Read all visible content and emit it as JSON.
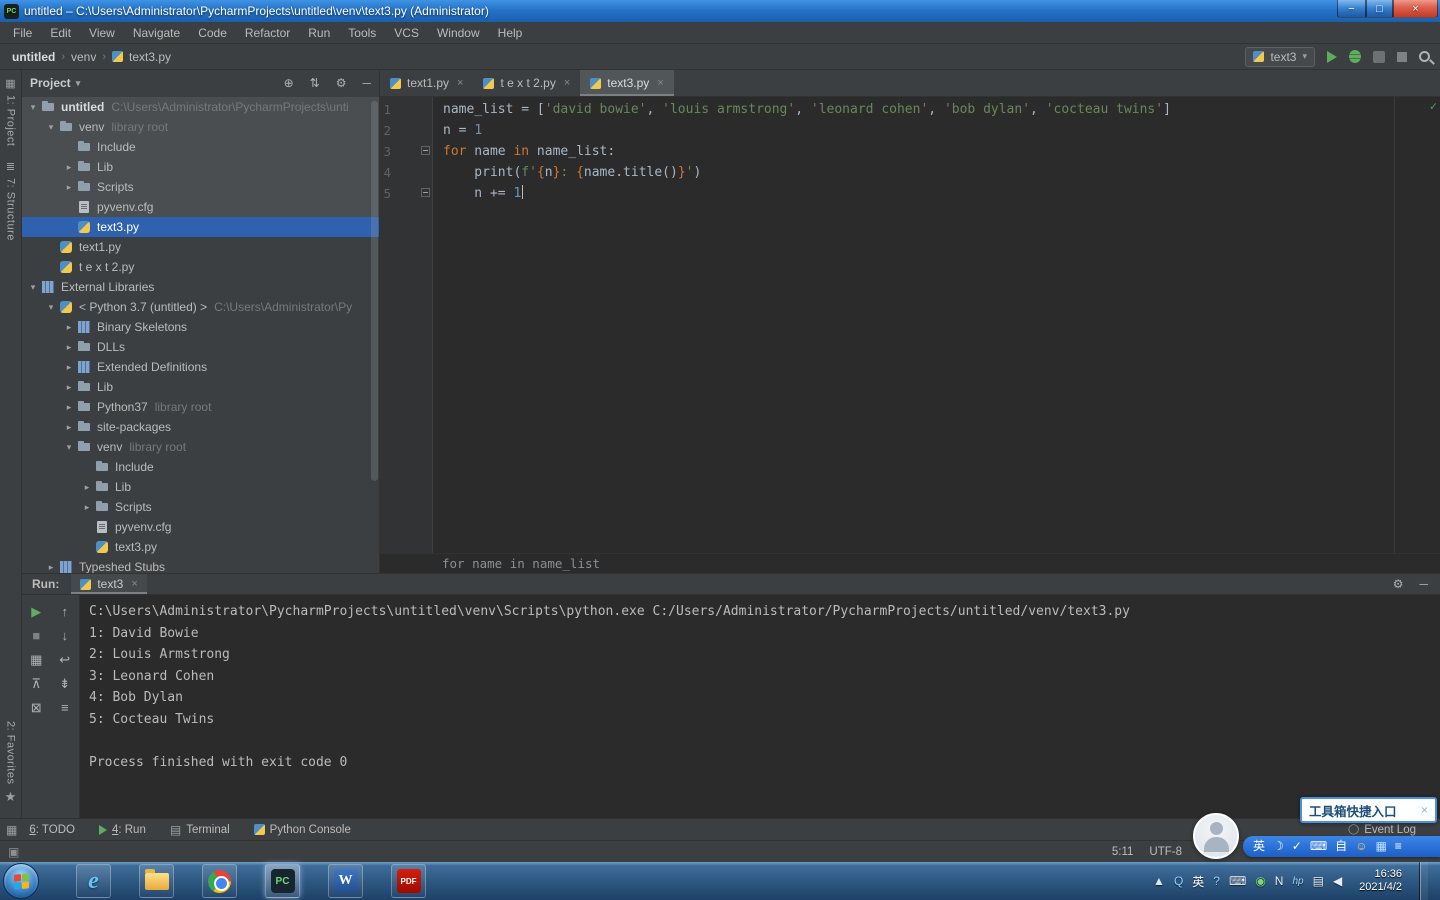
{
  "window": {
    "title": "untitled – C:\\Users\\Administrator\\PycharmProjects\\untitled\\venv\\text3.py (Administrator)",
    "app_icon": "PC"
  },
  "icons": {
    "min": "−",
    "max": "□",
    "close": "×",
    "tree_expanded": "▾",
    "tree_collapsed": "▸",
    "breadcrumb_sep": "›",
    "dropdown": "▾",
    "tab_close": "×",
    "check": "✓",
    "terminal": "▤",
    "circle": "◯",
    "panel_toggle": "▣",
    "switcher": "▦"
  },
  "colors": {
    "selection": "#2E62AE",
    "accent_green": "#5CAD5C",
    "title_blue": "#2573C8",
    "string_green": "#6A8759",
    "keyword_orange": "#CC7832"
  },
  "menu": [
    "File",
    "Edit",
    "View",
    "Navigate",
    "Code",
    "Refactor",
    "Run",
    "Tools",
    "VCS",
    "Window",
    "Help"
  ],
  "toolbar": {
    "breadcrumbs": [
      "untitled",
      "venv",
      "text3.py"
    ],
    "run_config": "text3"
  },
  "left_stripe": {
    "top": [
      {
        "label": "1: Project",
        "icon": "▦"
      },
      {
        "label": "7: Structure",
        "icon": "≣"
      }
    ],
    "bottom": [
      {
        "label": "2: Favorites",
        "icon": "★"
      }
    ]
  },
  "project_panel": {
    "header": "Project",
    "header_icons": [
      {
        "name": "locate-icon",
        "glyph": "⊕"
      },
      {
        "name": "collapse-all-icon",
        "glyph": "⇅"
      },
      {
        "name": "settings-icon",
        "glyph": "⚙"
      },
      {
        "name": "hide-panel-icon",
        "glyph": "─"
      }
    ],
    "tree": [
      {
        "label": "untitled",
        "suffix": "C:\\Users\\Administrator\\PycharmProjects\\unti",
        "level": 0,
        "icon": "folder",
        "arrow": "down",
        "bold": true,
        "light": true
      },
      {
        "label": "venv",
        "suffix": "library root",
        "level": 1,
        "icon": "folder",
        "arrow": "down",
        "light": true
      },
      {
        "label": "Include",
        "level": 2,
        "icon": "folder",
        "arrow": "none",
        "light": true
      },
      {
        "label": "Lib",
        "level": 2,
        "icon": "folder",
        "arrow": "right",
        "light": true
      },
      {
        "label": "Scripts",
        "level": 2,
        "icon": "folder",
        "arrow": "right",
        "light": true
      },
      {
        "label": "pyvenv.cfg",
        "level": 2,
        "icon": "cfg",
        "arrow": "none",
        "light": true
      },
      {
        "label": "text3.py",
        "level": 2,
        "icon": "py",
        "arrow": "none",
        "selected": true
      },
      {
        "label": "text1.py",
        "level": 1,
        "icon": "py",
        "arrow": "none"
      },
      {
        "label": "t e x t 2.py",
        "level": 1,
        "icon": "py",
        "arrow": "none"
      },
      {
        "label": "External Libraries",
        "level": 0,
        "icon": "libs",
        "arrow": "down"
      },
      {
        "label": "< Python 3.7 (untitled) >",
        "suffix": "C:\\Users\\Administrator\\Py",
        "level": 1,
        "icon": "python",
        "arrow": "down"
      },
      {
        "label": "Binary Skeletons",
        "level": 2,
        "icon": "libs",
        "arrow": "right"
      },
      {
        "label": "DLLs",
        "level": 2,
        "icon": "folder",
        "arrow": "right"
      },
      {
        "label": "Extended Definitions",
        "level": 2,
        "icon": "libs",
        "arrow": "right"
      },
      {
        "label": "Lib",
        "level": 2,
        "icon": "folder",
        "arrow": "right"
      },
      {
        "label": "Python37",
        "suffix": "library root",
        "level": 2,
        "icon": "folder",
        "arrow": "right"
      },
      {
        "label": "site-packages",
        "level": 2,
        "icon": "folder",
        "arrow": "right"
      },
      {
        "label": "venv",
        "suffix": "library root",
        "level": 2,
        "icon": "folder",
        "arrow": "down"
      },
      {
        "label": "Include",
        "level": 3,
        "icon": "folder",
        "arrow": "none"
      },
      {
        "label": "Lib",
        "level": 3,
        "icon": "folder",
        "arrow": "right"
      },
      {
        "label": "Scripts",
        "level": 3,
        "icon": "folder",
        "arrow": "right"
      },
      {
        "label": "pyvenv.cfg",
        "level": 3,
        "icon": "cfg",
        "arrow": "none"
      },
      {
        "label": "text3.py",
        "level": 3,
        "icon": "py",
        "arrow": "none"
      },
      {
        "label": "Typeshed Stubs",
        "level": 1,
        "icon": "libs",
        "arrow": "right"
      }
    ]
  },
  "editor": {
    "tabs": [
      {
        "label": "text1.py",
        "active": false
      },
      {
        "label": "t e x t 2.py",
        "active": false
      },
      {
        "label": "text3.py",
        "active": true
      }
    ],
    "lines": [
      {
        "n": 1,
        "segs": [
          {
            "t": "name_list = [",
            "c": "plain"
          },
          {
            "t": "'david bowie'",
            "c": "str"
          },
          {
            "t": ", ",
            "c": "plain"
          },
          {
            "t": "'louis armstrong'",
            "c": "str"
          },
          {
            "t": ", ",
            "c": "plain"
          },
          {
            "t": "'leonard cohen'",
            "c": "str"
          },
          {
            "t": ", ",
            "c": "plain"
          },
          {
            "t": "'bob dylan'",
            "c": "str"
          },
          {
            "t": ", ",
            "c": "plain"
          },
          {
            "t": "'cocteau twins'",
            "c": "str"
          },
          {
            "t": "]",
            "c": "plain"
          }
        ]
      },
      {
        "n": 2,
        "segs": [
          {
            "t": "n = ",
            "c": "plain"
          },
          {
            "t": "1",
            "c": "num"
          }
        ]
      },
      {
        "n": 3,
        "fold": "start",
        "segs": [
          {
            "t": "for",
            "c": "kw"
          },
          {
            "t": " name ",
            "c": "plain"
          },
          {
            "t": "in",
            "c": "kw"
          },
          {
            "t": " name_list:",
            "c": "plain"
          }
        ]
      },
      {
        "n": 4,
        "segs": [
          {
            "t": "    print(",
            "c": "plain"
          },
          {
            "t": "f'",
            "c": "str"
          },
          {
            "t": "{",
            "c": "brace"
          },
          {
            "t": "n",
            "c": "plain"
          },
          {
            "t": "}",
            "c": "brace"
          },
          {
            "t": ": ",
            "c": "str"
          },
          {
            "t": "{",
            "c": "brace"
          },
          {
            "t": "name.title()",
            "c": "plain"
          },
          {
            "t": "}",
            "c": "brace"
          },
          {
            "t": "'",
            "c": "str"
          },
          {
            "t": ")",
            "c": "plain"
          }
        ]
      },
      {
        "n": 5,
        "fold": "end",
        "caret": true,
        "segs": [
          {
            "t": "    n += ",
            "c": "plain"
          },
          {
            "t": "1",
            "c": "num"
          }
        ]
      }
    ],
    "context_bar": "for name in name_list"
  },
  "run_panel": {
    "label": "Run:",
    "tab": "text3",
    "header_icons": [
      {
        "name": "settings-icon",
        "glyph": "⚙"
      },
      {
        "name": "minimize-icon",
        "glyph": "─"
      }
    ],
    "toolbar_col1": [
      {
        "name": "rerun-button",
        "glyph": "▶",
        "color": "#61AD61"
      },
      {
        "name": "stop-button",
        "glyph": "■",
        "color": "#7E8284"
      },
      {
        "name": "restore-layout-button",
        "glyph": "▦",
        "color": "#AFB1B3"
      },
      {
        "name": "pin-tab-button",
        "glyph": "⊼",
        "color": "#AFB1B3"
      },
      {
        "name": "clear-all-button",
        "glyph": "⊠",
        "color": "#AFB1B3"
      }
    ],
    "toolbar_col2": [
      {
        "name": "up-stack-trace-button",
        "glyph": "↑",
        "color": "#AFB1B3"
      },
      {
        "name": "down-stack-trace-button",
        "glyph": "↓",
        "color": "#AFB1B3"
      },
      {
        "name": "soft-wrap-button",
        "glyph": "↩",
        "color": "#AFB1B3"
      },
      {
        "name": "scroll-to-end-button",
        "glyph": "⇟",
        "color": "#AFB1B3"
      },
      {
        "name": "print-console-button",
        "glyph": "≡",
        "color": "#AFB1B3"
      }
    ],
    "console": [
      "C:\\Users\\Administrator\\PycharmProjects\\untitled\\venv\\Scripts\\python.exe C:/Users/Administrator/PycharmProjects/untitled/venv/text3.py",
      "1: David Bowie",
      "2: Louis Armstrong",
      "3: Leonard Cohen",
      "4: Bob Dylan",
      "5: Cocteau Twins",
      "",
      "Process finished with exit code 0"
    ]
  },
  "bottom_bar": {
    "items": [
      {
        "key": "6",
        "rest": ": TODO",
        "icon": ""
      },
      {
        "key": "4",
        "rest": ": Run",
        "icon": "run"
      },
      {
        "key": "",
        "rest": "Terminal",
        "icon": "terminal"
      },
      {
        "key": "",
        "rest": "Python Console",
        "icon": "python"
      }
    ],
    "event_log": "Event Log"
  },
  "status_bar": {
    "caret": "5:11",
    "encoding": "UTF-8"
  },
  "overlays": {
    "toolbox_popup": "工具箱快捷入口",
    "popup_close": "×",
    "ime_icons": [
      {
        "glyph": "英",
        "color": "#FFFFFF"
      },
      {
        "glyph": "☽",
        "color": "#FFFFFF"
      },
      {
        "glyph": "✓",
        "color": "#FFFFFF"
      },
      {
        "glyph": "⌨",
        "color": "#FFFFFF"
      },
      {
        "glyph": "自",
        "color": "#FFFFFF"
      },
      {
        "glyph": "☺",
        "color": "#FFD34D"
      },
      {
        "glyph": "▦",
        "color": "#BFE3FF"
      },
      {
        "glyph": "≡",
        "color": "#FFFFFF"
      }
    ]
  },
  "taskbar": {
    "apps": [
      {
        "name": "ie",
        "label": "e"
      },
      {
        "name": "explorer",
        "label": ""
      },
      {
        "name": "chrome",
        "label": ""
      },
      {
        "name": "pycharm",
        "label": "PC",
        "active": true
      },
      {
        "name": "word",
        "label": "W"
      },
      {
        "name": "pdf",
        "label": "PDF"
      }
    ],
    "tray": [
      {
        "name": "hidden-icons",
        "glyph": "▲",
        "color": "#D6E6F5"
      },
      {
        "name": "search-tray",
        "glyph": "Q",
        "color": "#8FD0FF"
      },
      {
        "name": "ime-lang",
        "glyph": "英",
        "color": "#FFFFFF"
      },
      {
        "name": "help-tray",
        "glyph": "?",
        "color": "#8FD0FF"
      },
      {
        "name": "keyboard-tray",
        "glyph": "⌨",
        "color": "#E8EEF4"
      },
      {
        "name": "safety-tray",
        "glyph": "◉",
        "color": "#7CD672"
      },
      {
        "name": "note-tray",
        "glyph": "N",
        "color": "#E8EEF4"
      },
      {
        "name": "hp-tray",
        "glyph": "hp",
        "color": "#9FD3F2"
      },
      {
        "name": "display-tray",
        "glyph": "▤",
        "color": "#E8EEF4"
      },
      {
        "name": "volume-tray",
        "glyph": "◀",
        "color": "#E8EEF4"
      }
    ],
    "clock_time": "16:36",
    "clock_date": "2021/4/2"
  }
}
